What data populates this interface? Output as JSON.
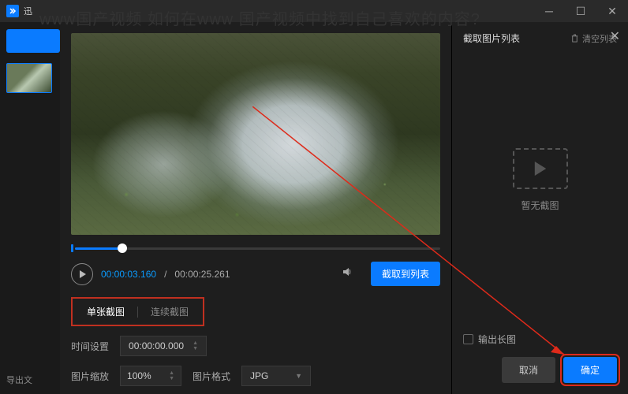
{
  "overlay": {
    "title": "www国产视频 如何在www 国产视频中找到自己喜欢的内容?"
  },
  "window": {
    "app_prefix": "迅"
  },
  "modal": {
    "close": "✕",
    "video": {
      "current_time": "00:00:03.160",
      "total_time": "00:00:25.261",
      "capture_button": "截取到列表"
    },
    "tabs": {
      "single": "单张截图",
      "continuous": "连续截图"
    },
    "settings": {
      "time_label": "时间设置",
      "time_value": "00:00:00.000",
      "zoom_label": "图片缩放",
      "zoom_value": "100%",
      "format_label": "图片格式",
      "format_value": "JPG"
    },
    "right": {
      "header": "截取图片列表",
      "clear": "清空列表",
      "empty": "暂无截图",
      "long_image_checkbox": "输出长图",
      "cancel": "取消",
      "confirm": "确定"
    }
  },
  "footer": {
    "export_label": "导出文"
  }
}
